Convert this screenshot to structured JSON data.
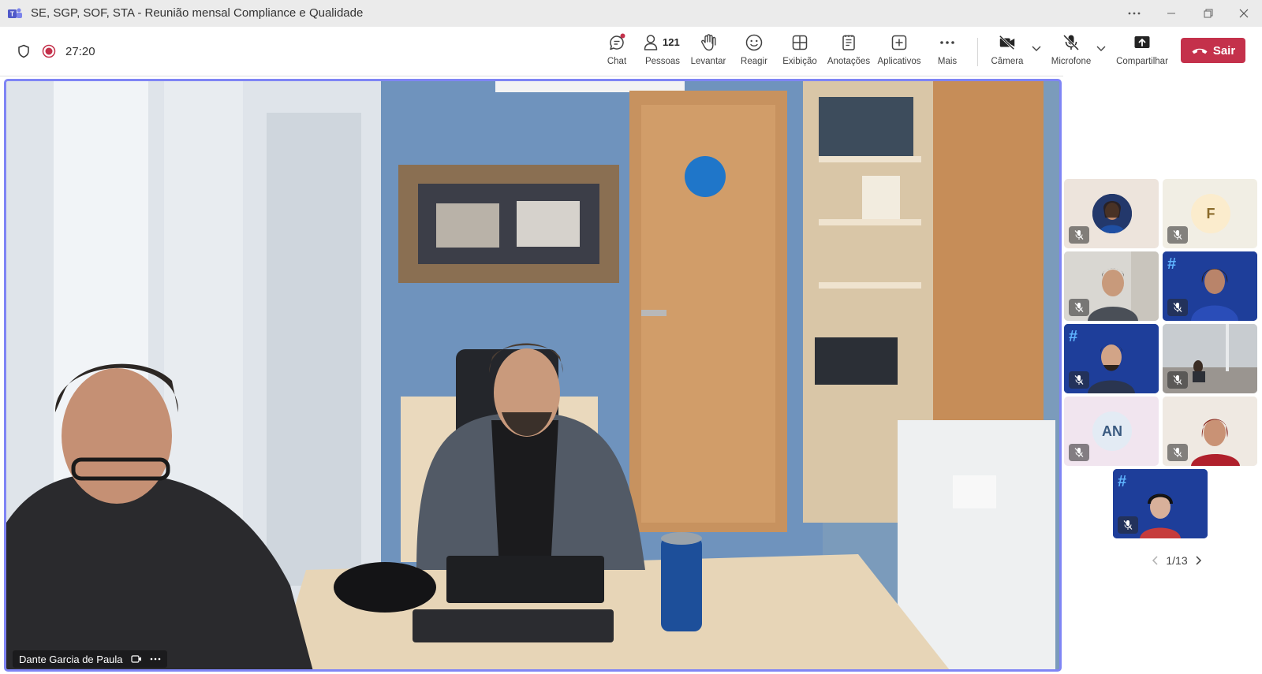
{
  "window": {
    "title": "SE, SGP, SOF, STA - Reunião mensal Compliance e Qualidade",
    "controls": [
      "more",
      "minimize",
      "restore",
      "close"
    ]
  },
  "meeting": {
    "timer": "27:20",
    "recording": true
  },
  "toolbar": {
    "chat_label": "Chat",
    "people_label": "Pessoas",
    "people_count": "121",
    "raise_label": "Levantar",
    "react_label": "Reagir",
    "view_label": "Exibição",
    "notes_label": "Anotações",
    "apps_label": "Aplicativos",
    "more_label": "Mais",
    "camera_label": "Câmera",
    "mic_label": "Microfone",
    "share_label": "Compartilhar",
    "leave_label": "Sair"
  },
  "main_video": {
    "participant_name": "Dante Garcia de Paula"
  },
  "gallery": {
    "tiles": [
      {
        "type": "photo-avatar",
        "muted": true
      },
      {
        "type": "initials",
        "initials": "F",
        "muted": true
      },
      {
        "type": "video",
        "muted": true
      },
      {
        "type": "video-gptw",
        "muted": true
      },
      {
        "type": "video-gptw",
        "muted": true
      },
      {
        "type": "video",
        "muted": true
      },
      {
        "type": "initials",
        "initials": "AN",
        "muted": true
      },
      {
        "type": "video",
        "muted": true
      },
      {
        "type": "video-gptw",
        "muted": true
      }
    ],
    "pager": "1/13"
  },
  "colors": {
    "accent": "#7f85f5",
    "leave": "#c4314b",
    "recording": "#c4314b"
  }
}
